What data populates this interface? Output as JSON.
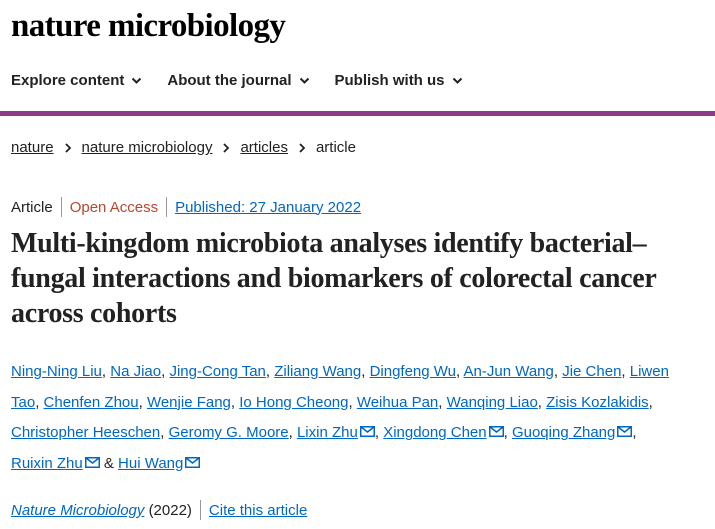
{
  "site": {
    "logo": "nature microbiology"
  },
  "nav": {
    "items": [
      {
        "label": "Explore content"
      },
      {
        "label": "About the journal"
      },
      {
        "label": "Publish with us"
      }
    ]
  },
  "breadcrumb": {
    "items": [
      "nature",
      "nature microbiology",
      "articles",
      "article"
    ]
  },
  "meta": {
    "type": "Article",
    "access": "Open Access",
    "published": "Published: 27 January 2022"
  },
  "title": "Multi-kingdom microbiota analyses identify bacterial–fungal interactions and biomarkers of colorectal cancer across cohorts",
  "authors": [
    {
      "name": "Ning-Ning Liu",
      "email": false
    },
    {
      "name": "Na Jiao",
      "email": false
    },
    {
      "name": "Jing-Cong Tan",
      "email": false
    },
    {
      "name": "Ziliang Wang",
      "email": false
    },
    {
      "name": "Dingfeng Wu",
      "email": false
    },
    {
      "name": "An-Jun Wang",
      "email": false
    },
    {
      "name": "Jie Chen",
      "email": false
    },
    {
      "name": "Liwen Tao",
      "email": false
    },
    {
      "name": "Chenfen Zhou",
      "email": false
    },
    {
      "name": "Wenjie Fang",
      "email": false
    },
    {
      "name": "Io Hong Cheong",
      "email": false
    },
    {
      "name": "Weihua Pan",
      "email": false
    },
    {
      "name": "Wanqing Liao",
      "email": false
    },
    {
      "name": "Zisis Kozlakidis",
      "email": false
    },
    {
      "name": "Christopher Heeschen",
      "email": false
    },
    {
      "name": "Geromy G. Moore",
      "email": false
    },
    {
      "name": "Lixin Zhu",
      "email": true
    },
    {
      "name": "Xingdong Chen",
      "email": true
    },
    {
      "name": "Guoqing Zhang",
      "email": true
    },
    {
      "name": "Ruixin Zhu",
      "email": true
    },
    {
      "name": "Hui Wang",
      "email": true
    }
  ],
  "author_separators": {
    "comma": ", ",
    "and": " & "
  },
  "citation": {
    "journal": "Nature Microbiology",
    "year": "(2022)",
    "cite_label": "Cite this article"
  },
  "colors": {
    "accent_bar": "#8c3a8e",
    "link": "#0067c5",
    "open_access": "#b6482f"
  },
  "icons": {
    "chevron": "chevron-down-icon",
    "email": "mail-icon",
    "crumb": "chevron-right-icon"
  }
}
